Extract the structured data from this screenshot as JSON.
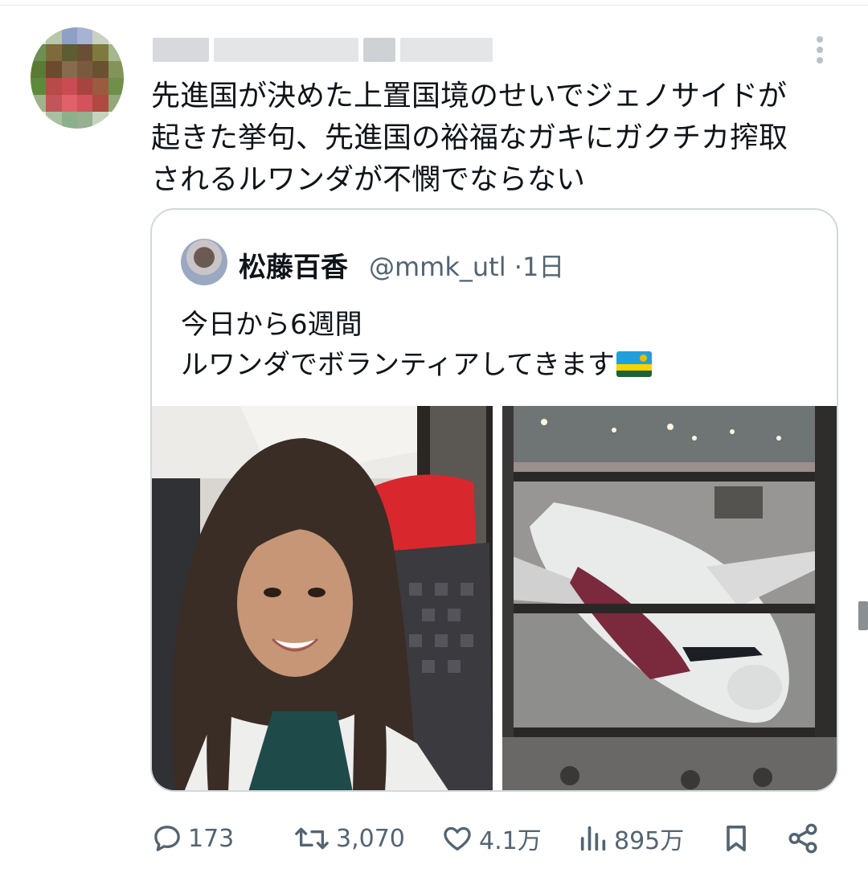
{
  "tweet": {
    "text_lines": [
      "先進国が決めた上置国境のせいでジェノサイドが",
      "起きた挙句、先進国の裕福なガキにガクチカ搾取",
      "されるルワンダが不憫でならない"
    ]
  },
  "quote": {
    "display_name": "松藤百香",
    "handle": "@mmk_utl",
    "separator": "·",
    "time": "1日",
    "text_line1": "今日から6週間",
    "text_line2": "ルワンダでボランティアしてきます",
    "flag_icon": "rwanda-flag-icon"
  },
  "actions": {
    "replies": "173",
    "retweets": "3,070",
    "likes": "4.1万",
    "views": "895万"
  },
  "colors": {
    "text": "#0f1419",
    "secondary": "#536471",
    "border": "#cfd9de"
  }
}
